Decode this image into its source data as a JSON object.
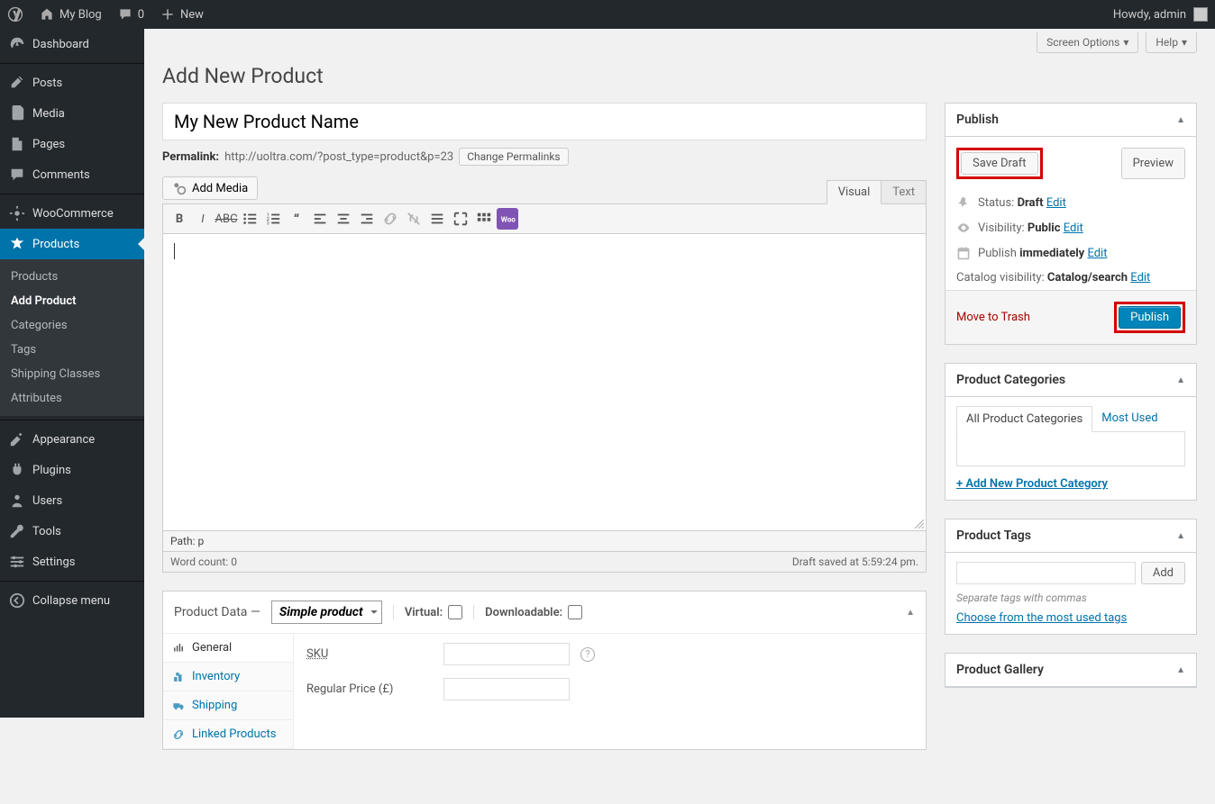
{
  "adminbar": {
    "site_name": "My Blog",
    "comments_count": "0",
    "new_label": "New",
    "howdy": "Howdy, admin"
  },
  "sidebar": {
    "items": [
      {
        "label": "Dashboard"
      },
      {
        "label": "Posts"
      },
      {
        "label": "Media"
      },
      {
        "label": "Pages"
      },
      {
        "label": "Comments"
      },
      {
        "label": "WooCommerce"
      },
      {
        "label": "Products"
      },
      {
        "label": "Appearance"
      },
      {
        "label": "Plugins"
      },
      {
        "label": "Users"
      },
      {
        "label": "Tools"
      },
      {
        "label": "Settings"
      }
    ],
    "products_submenu": [
      {
        "label": "Products"
      },
      {
        "label": "Add Product"
      },
      {
        "label": "Categories"
      },
      {
        "label": "Tags"
      },
      {
        "label": "Shipping Classes"
      },
      {
        "label": "Attributes"
      }
    ],
    "collapse_label": "Collapse menu"
  },
  "topctrls": {
    "screen_options": "Screen Options",
    "help": "Help"
  },
  "page_title": "Add New Product",
  "title_value": "My New Product Name",
  "permalink": {
    "label": "Permalink:",
    "url": "http://uoltra.com/?post_type=product&p=23",
    "change_btn": "Change Permalinks"
  },
  "editor": {
    "add_media_btn": "Add Media",
    "tabs": {
      "visual": "Visual",
      "text": "Text"
    },
    "status_path_label": "Path:",
    "status_path": "p",
    "word_count_label": "Word count:",
    "word_count": "0",
    "draft_saved": "Draft saved at 5:59:24 pm."
  },
  "publish": {
    "title": "Publish",
    "save_draft": "Save Draft",
    "preview": "Preview",
    "status_label": "Status:",
    "status_value": "Draft",
    "visibility_label": "Visibility:",
    "visibility_value": "Public",
    "publish_label": "Publish",
    "publish_value": "immediately",
    "catalog_label": "Catalog visibility:",
    "catalog_value": "Catalog/search",
    "edit": "Edit",
    "trash": "Move to Trash",
    "submit": "Publish"
  },
  "categories": {
    "title": "Product Categories",
    "tab_all": "All Product Categories",
    "tab_most": "Most Used",
    "add_new": "+ Add New Product Category"
  },
  "tags": {
    "title": "Product Tags",
    "add_btn": "Add",
    "hint": "Separate tags with commas",
    "choose": "Choose from the most used tags"
  },
  "gallery": {
    "title": "Product Gallery"
  },
  "product_data": {
    "title": "Product Data —",
    "select_value": "Simple product",
    "virtual_label": "Virtual:",
    "downloadable_label": "Downloadable:",
    "tabs": [
      {
        "label": "General"
      },
      {
        "label": "Inventory"
      },
      {
        "label": "Shipping"
      },
      {
        "label": "Linked Products"
      }
    ],
    "sku_label": "SKU",
    "price_label": "Regular Price (£)"
  }
}
